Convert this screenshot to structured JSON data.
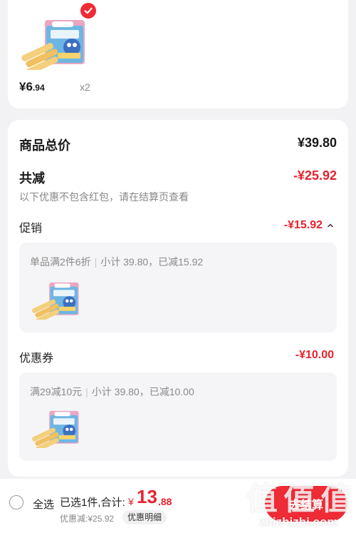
{
  "cart_item": {
    "price_symbol": "¥",
    "price_int": "6",
    "price_dec": ".94",
    "quantity": "x2",
    "selected": true,
    "check_icon": "check-icon",
    "image_icon": "egg-roll-snack-box-icon"
  },
  "summary": {
    "goods_total_label": "商品总价",
    "goods_total_value": "¥39.80",
    "total_discount_label": "共减",
    "total_discount_value": "-¥25.92",
    "note": "以下优惠不包含红包，请在结算页查看"
  },
  "promotion": {
    "label": "促销",
    "value": "-¥15.92",
    "collapse_icon": "chevron-up-icon",
    "rule": "单品满2件6折",
    "subtotal": "小计 39.80，已减15.92"
  },
  "coupon": {
    "label": "优惠券",
    "value": "-¥10.00",
    "rule": "满29减10元",
    "subtotal": "小计 39.80，已减10.00"
  },
  "bottom_bar": {
    "select_all_label": "全选",
    "selected_text": "已选1件,合计:",
    "total_symbol": "¥",
    "total_int": "13",
    "total_dec": ".88",
    "discount_line": "优惠减:¥25.92",
    "detail_button": "优惠明细",
    "checkout_button": "去结算"
  },
  "watermark": {
    "logo_text": "值 值 值",
    "url": "zhizhizhi.com"
  },
  "colors": {
    "accent": "#ef2b36",
    "price_red": "#e8232f",
    "background": "#f2f2f4"
  }
}
